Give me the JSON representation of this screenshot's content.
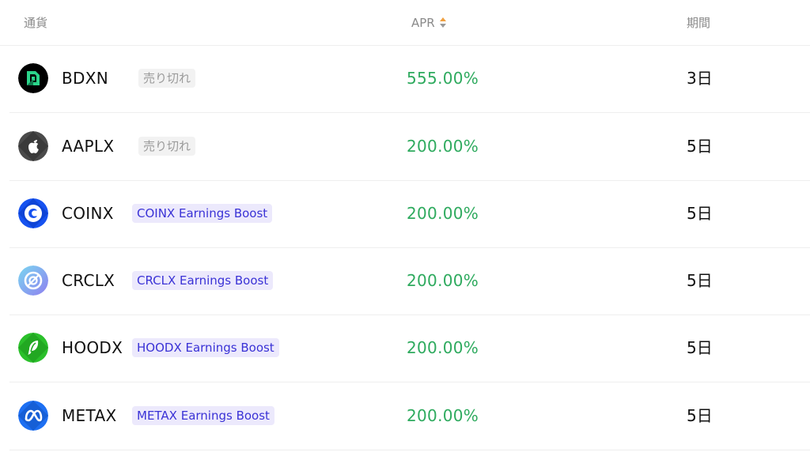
{
  "header": {
    "currency": "通貨",
    "apr": "APR",
    "period": "期間"
  },
  "colors": {
    "apr_green": "#2eaa5e",
    "boost_text": "#3a32d6",
    "boost_bg": "#ece9fc",
    "soldout_text": "#9a9a9a",
    "soldout_bg": "#f2f2f2",
    "sort_up": "#f0a040"
  },
  "rows": [
    {
      "symbol": "BDXN",
      "icon": "bdxn-logo-icon",
      "tag": "売り切れ",
      "tag_type": "soldout",
      "apr": "555.00%",
      "period": "3日"
    },
    {
      "symbol": "AAPLX",
      "icon": "apple-logo-icon",
      "tag": "売り切れ",
      "tag_type": "soldout",
      "apr": "200.00%",
      "period": "5日"
    },
    {
      "symbol": "COINX",
      "icon": "coinbase-logo-icon",
      "tag": "COINX Earnings Boost",
      "tag_type": "boost",
      "apr": "200.00%",
      "period": "5日"
    },
    {
      "symbol": "CRCLX",
      "icon": "circle-logo-icon",
      "tag": "CRCLX Earnings Boost",
      "tag_type": "boost",
      "apr": "200.00%",
      "period": "5日"
    },
    {
      "symbol": "HOODX",
      "icon": "robinhood-logo-icon",
      "tag": "HOODX Earnings Boost",
      "tag_type": "boost",
      "apr": "200.00%",
      "period": "5日"
    },
    {
      "symbol": "METAX",
      "icon": "meta-logo-icon",
      "tag": "METAX Earnings Boost",
      "tag_type": "boost",
      "apr": "200.00%",
      "period": "5日"
    }
  ]
}
